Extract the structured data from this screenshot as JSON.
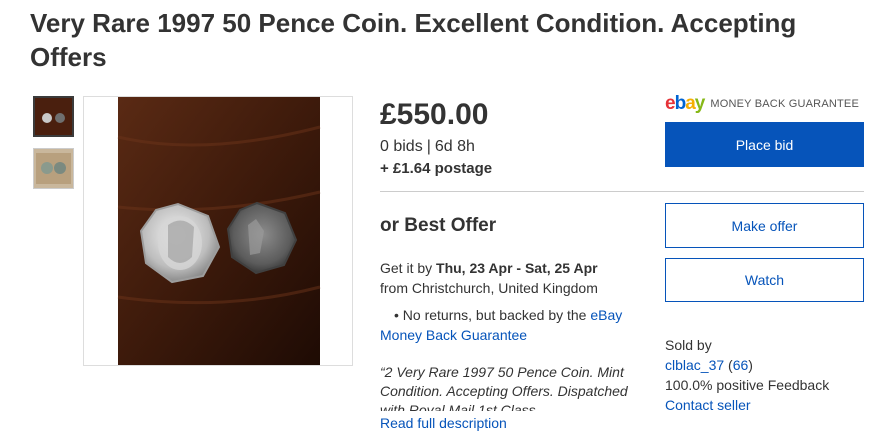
{
  "listing": {
    "title": "Very Rare 1997 50 Pence Coin. Excellent Condition. Accepting Offers"
  },
  "gallery": {
    "thumbnails": [
      "coins-photo-1",
      "coins-photo-2"
    ],
    "main_image": "two-50p-coins-on-wood"
  },
  "pricing": {
    "price": "£550.00",
    "bids": "0 bids",
    "separator": "|",
    "time_left": "6d 8h",
    "postage": "+ £1.64 postage",
    "best_offer": "or Best Offer"
  },
  "delivery": {
    "prefix": "Get it by ",
    "dates": "Thu, 23 Apr - Sat, 25 Apr",
    "from": "from Christchurch, United Kingdom"
  },
  "returns": {
    "text": "• No returns, but backed by the ",
    "link": "eBay Money Back Guarantee"
  },
  "description": {
    "excerpt": "“2 Very Rare 1997 50 Pence Coin. Mint Condition. Accepting Offers. Dispatched with Royal Mail 1st Class.",
    "read_more": "Read full description"
  },
  "guarantee": {
    "logo_e": "e",
    "logo_b": "b",
    "logo_a": "a",
    "logo_y": "y",
    "label": "MONEY BACK GUARANTEE"
  },
  "actions": {
    "place_bid": "Place bid",
    "make_offer": "Make offer",
    "watch": "Watch"
  },
  "seller": {
    "sold_by": "Sold by",
    "name": "clblac_37",
    "open_paren": " (",
    "feedback_count": "66",
    "close_paren": ")",
    "positive": "100.0% positive Feedback",
    "contact": "Contact seller"
  },
  "colors": {
    "link": "#0654ba",
    "primary_button": "#0654ba",
    "wood_dark": "#3a1a0c"
  }
}
